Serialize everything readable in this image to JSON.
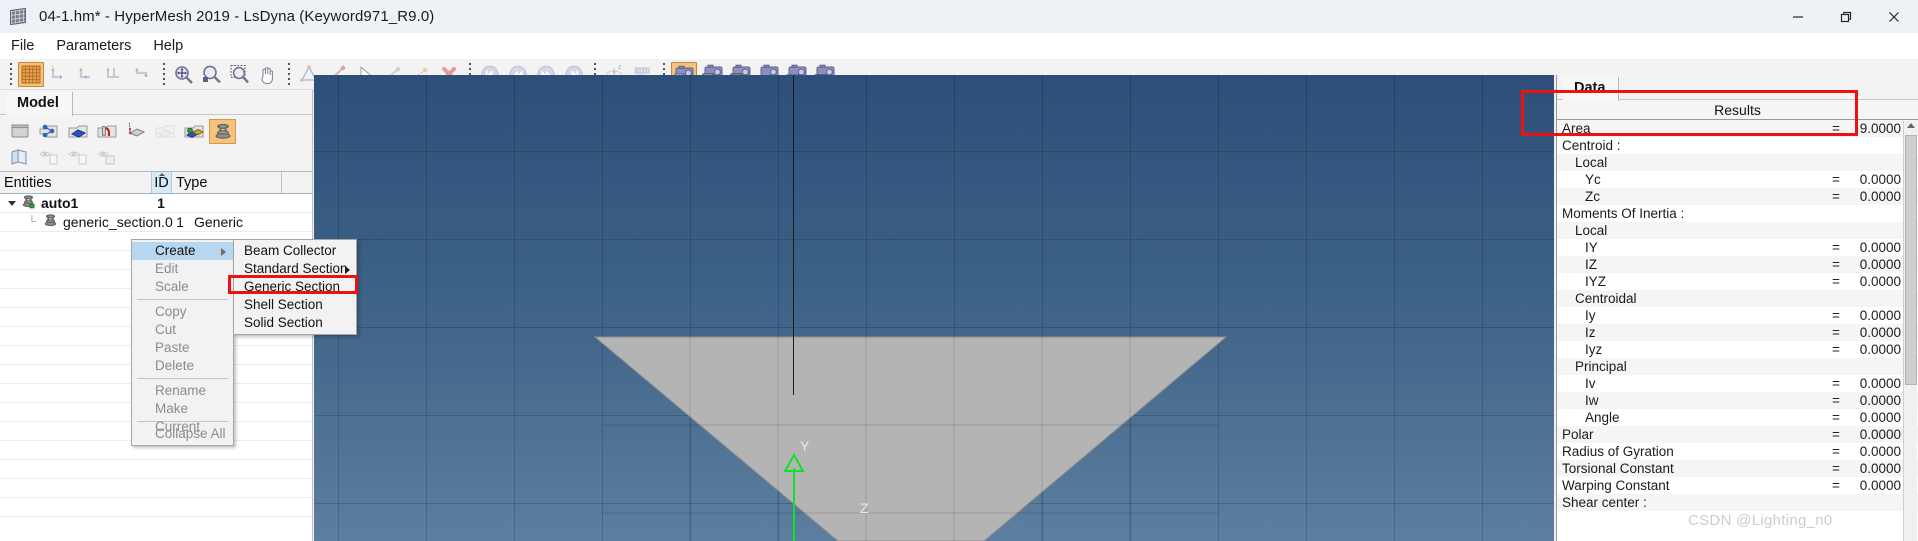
{
  "window": {
    "title": "04-1.hm* - HyperMesh 2019 - LsDyna (Keyword971_R9.0)",
    "app_icon": "hypermesh-grid-icon",
    "controls": {
      "minimize": "minimize-icon",
      "restore": "restore-icon",
      "close": "close-icon"
    }
  },
  "menubar": {
    "items": [
      {
        "label": "File"
      },
      {
        "label": "Parameters"
      },
      {
        "label": "Help"
      }
    ]
  },
  "toolbar": {
    "groups": [
      {
        "items": [
          {
            "name": "grid-view-icon",
            "active": true
          },
          {
            "name": "view-xy-icon",
            "active": false
          },
          {
            "name": "view-yz-icon",
            "active": false
          },
          {
            "name": "view-zx-icon",
            "active": false
          },
          {
            "name": "view-iso-icon",
            "active": false
          }
        ]
      },
      {
        "items": [
          {
            "name": "fit-to-screen-icon",
            "active": false
          },
          {
            "name": "zoom-in-icon",
            "active": false
          },
          {
            "name": "zoom-window-icon",
            "active": false
          },
          {
            "name": "pan-hand-icon",
            "active": false
          }
        ]
      },
      {
        "items": [
          {
            "name": "measure-angle-icon",
            "active": false
          },
          {
            "name": "measure-distance-icon",
            "active": false
          },
          {
            "name": "pick-arrow-icon",
            "active": false
          },
          {
            "name": "node-distance-icon",
            "active": false
          },
          {
            "name": "node-edit-icon",
            "active": false
          },
          {
            "name": "delete-x-icon",
            "active": false
          }
        ]
      },
      {
        "items": [
          {
            "name": "first-frame-icon",
            "active": false
          },
          {
            "name": "previous-frame-icon",
            "active": false
          },
          {
            "name": "next-frame-icon",
            "active": false
          },
          {
            "name": "last-frame-icon",
            "active": false
          }
        ]
      },
      {
        "items": [
          {
            "name": "coordinate-system-icon",
            "active": false
          },
          {
            "name": "caliper-icon",
            "active": false
          }
        ]
      },
      {
        "items": [
          {
            "name": "capture-save-icon",
            "active": true
          },
          {
            "name": "capture-window-icon",
            "active": false
          },
          {
            "name": "capture-client-icon",
            "active": false
          },
          {
            "name": "capture-list-icon",
            "active": false
          },
          {
            "name": "capture-region-icon",
            "active": false
          },
          {
            "name": "capture-image-icon",
            "active": false
          }
        ]
      }
    ]
  },
  "model_browser": {
    "tab_label": "Model",
    "tool_icons_row1": [
      "component-icon",
      "connector-icon",
      "property-icon",
      "material-icon",
      "thickness-icon",
      "group-disabled-icon",
      "assembly-icon",
      "beamsection-icon"
    ],
    "tool_icons_row2": [
      "show-hide-icon",
      "display-none-icon",
      "display-reverse-icon",
      "display-all-icon"
    ],
    "columns": [
      {
        "label": "Entities"
      },
      {
        "label": "ID"
      },
      {
        "label": "Type"
      }
    ],
    "rows": [
      {
        "name": "auto1",
        "id": "1",
        "type": "",
        "level": 0,
        "icon": "beamsection-collector-icon",
        "expanded": true
      },
      {
        "name": "generic_section.0",
        "id": "1",
        "type": "Generic",
        "level": 1,
        "icon": "beamsection-icon",
        "expanded": false
      }
    ]
  },
  "context_menu": {
    "items": [
      {
        "label": "Create",
        "enabled": true,
        "selected": true,
        "has_submenu": true
      },
      {
        "label": "Edit",
        "enabled": false,
        "selected": false,
        "has_submenu": false
      },
      {
        "label": "Scale",
        "enabled": false,
        "selected": false,
        "has_submenu": false
      },
      {
        "separator": true
      },
      {
        "label": "Copy",
        "enabled": false,
        "selected": false,
        "has_submenu": false
      },
      {
        "label": "Cut",
        "enabled": false,
        "selected": false,
        "has_submenu": false
      },
      {
        "label": "Paste",
        "enabled": false,
        "selected": false,
        "has_submenu": false
      },
      {
        "label": "Delete",
        "enabled": false,
        "selected": false,
        "has_submenu": false
      },
      {
        "separator": true
      },
      {
        "label": "Rename",
        "enabled": false,
        "selected": false,
        "has_submenu": false
      },
      {
        "label": "Make Current",
        "enabled": false,
        "selected": false,
        "has_submenu": false
      },
      {
        "separator": true
      },
      {
        "label": "Collapse All",
        "enabled": false,
        "selected": false,
        "has_submenu": false
      }
    ]
  },
  "submenu": {
    "items": [
      {
        "label": "Beam Collector",
        "has_submenu": false,
        "highlighted": false
      },
      {
        "label": "Standard Section",
        "has_submenu": true,
        "highlighted": false
      },
      {
        "label": "Generic Section",
        "has_submenu": false,
        "highlighted": true
      },
      {
        "label": "Shell Section",
        "has_submenu": false,
        "highlighted": false
      },
      {
        "label": "Solid Section",
        "has_submenu": false,
        "highlighted": false
      }
    ]
  },
  "viewport": {
    "axis_y_label": "Y",
    "axis_z_label": "Z",
    "background_top": "#2d4f79",
    "background_bottom": "#5d7f9f",
    "section_fill": "#b4b4b4",
    "axis_color": "#12e02a"
  },
  "data_panel": {
    "tab_label": "Data",
    "results_header": "Results",
    "rows": [
      {
        "label": "Area",
        "eq": "=",
        "value": "9.0000",
        "indent": 0
      },
      {
        "label": "Centroid :",
        "eq": "",
        "value": "",
        "indent": 0
      },
      {
        "label": "Local",
        "eq": "",
        "value": "",
        "indent": 1
      },
      {
        "label": "Yc",
        "eq": "=",
        "value": "0.0000",
        "indent": 2
      },
      {
        "label": "Zc",
        "eq": "=",
        "value": "0.0000",
        "indent": 2
      },
      {
        "label": "Moments Of Inertia :",
        "eq": "",
        "value": "",
        "indent": 0
      },
      {
        "label": "Local",
        "eq": "",
        "value": "",
        "indent": 1
      },
      {
        "label": "IY",
        "eq": "=",
        "value": "0.0000",
        "indent": 2
      },
      {
        "label": "IZ",
        "eq": "=",
        "value": "0.0000",
        "indent": 2
      },
      {
        "label": "IYZ",
        "eq": "=",
        "value": "0.0000",
        "indent": 2
      },
      {
        "label": "Centroidal",
        "eq": "",
        "value": "",
        "indent": 1
      },
      {
        "label": "Iy",
        "eq": "=",
        "value": "0.0000",
        "indent": 2
      },
      {
        "label": "Iz",
        "eq": "=",
        "value": "0.0000",
        "indent": 2
      },
      {
        "label": "Iyz",
        "eq": "=",
        "value": "0.0000",
        "indent": 2
      },
      {
        "label": "Principal",
        "eq": "",
        "value": "",
        "indent": 1
      },
      {
        "label": "Iv",
        "eq": "=",
        "value": "0.0000",
        "indent": 2
      },
      {
        "label": "Iw",
        "eq": "=",
        "value": "0.0000",
        "indent": 2
      },
      {
        "label": "Angle",
        "eq": "=",
        "value": "0.0000",
        "indent": 2
      },
      {
        "label": "Polar",
        "eq": "=",
        "value": "0.0000",
        "indent": 0
      },
      {
        "label": "Radius of Gyration",
        "eq": "=",
        "value": "0.0000",
        "indent": 0
      },
      {
        "label": "Torsional Constant",
        "eq": "=",
        "value": "0.0000",
        "indent": 0
      },
      {
        "label": "Warping Constant",
        "eq": "=",
        "value": "0.0000",
        "indent": 0
      },
      {
        "label": "Shear center :",
        "eq": "",
        "value": "",
        "indent": 0
      }
    ]
  },
  "annotations": {
    "highlight_color": "#ee1111",
    "boxes": [
      {
        "name": "generic-section-highlight"
      },
      {
        "name": "area-result-highlight"
      }
    ]
  },
  "watermark": {
    "text": "CSDN @Lighting_n0"
  }
}
